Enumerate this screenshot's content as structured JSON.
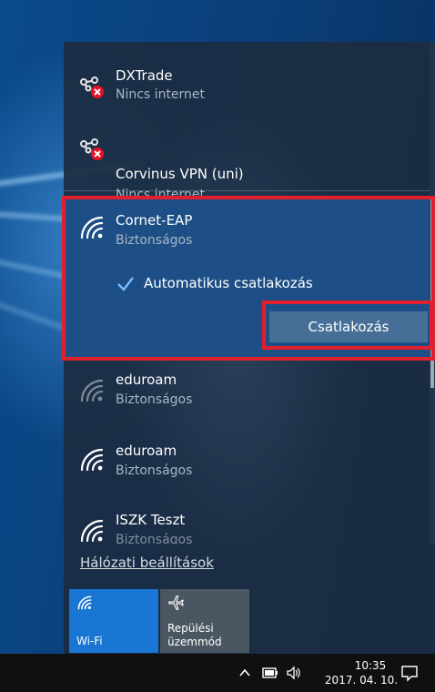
{
  "networks": [
    {
      "ssid": "DXTrade",
      "status": "Nincs internet",
      "icon": "network-no-internet-icon"
    },
    {
      "ssid": "Corvinus VPN (uni)",
      "status": "Nincs internet",
      "icon": "network-no-internet-icon"
    },
    {
      "ssid": "Cornet-EAP",
      "status": "Biztonságos",
      "icon": "wifi-icon"
    },
    {
      "ssid": "eduroam",
      "status": "Biztonságos",
      "icon": "wifi-weak-icon"
    },
    {
      "ssid": "eduroam",
      "status": "Biztonságos",
      "icon": "wifi-icon"
    },
    {
      "ssid": "ISZK Teszt",
      "status": "Biztonságos",
      "icon": "wifi-icon"
    }
  ],
  "selected": {
    "auto_connect_label": "Automatikus csatlakozás",
    "auto_connect_checked": true,
    "connect_label": "Csatlakozás"
  },
  "settings_link": "Hálózati beállítások",
  "quick_actions": [
    {
      "label": "Wi-Fi",
      "active": true,
      "icon": "wifi-icon"
    },
    {
      "label_line1": "Repülési",
      "label_line2": "üzemmód",
      "active": false,
      "icon": "airplane-icon"
    }
  ],
  "taskbar": {
    "time": "10:35",
    "date": "2017. 04. 10."
  },
  "colors": {
    "selected_bg": "#1d4f86",
    "active_tile": "#1976d2",
    "inactive_tile": "#4b5663",
    "annotation": "#e0202e",
    "accent": "#78b9ff"
  }
}
